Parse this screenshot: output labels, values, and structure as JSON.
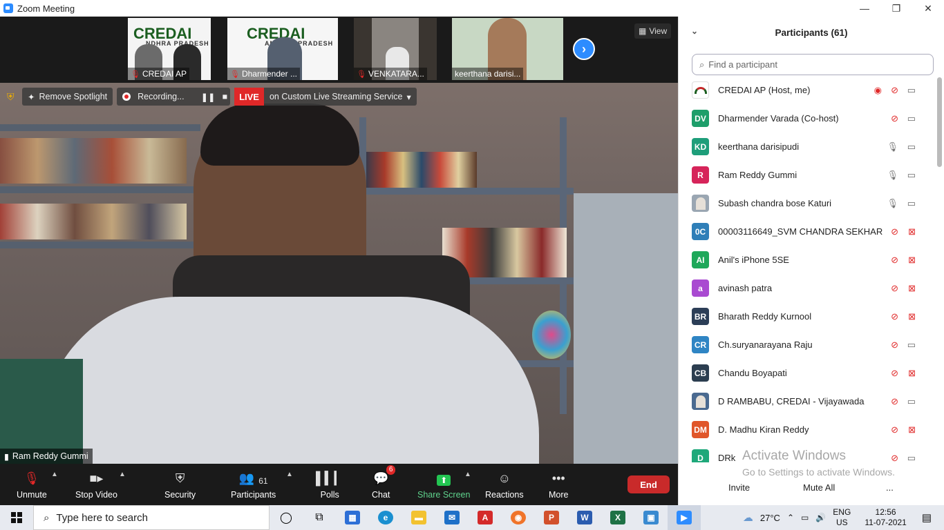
{
  "window": {
    "title": "Zoom Meeting",
    "minimize": "—",
    "maximize": "❐",
    "close": "✕"
  },
  "strip": {
    "thumbnails": [
      {
        "name": "CREDAI AP",
        "logo": "CREDAI",
        "sub": "NDHRA PRADESH"
      },
      {
        "name": "Dharmender ...",
        "logo": "CREDAI",
        "sub": "ANDHRA PRADESH"
      },
      {
        "name": "VENKATARA..."
      },
      {
        "name": "keerthana darisi..."
      }
    ],
    "view_label": "View"
  },
  "stage": {
    "remove_spotlight": "Remove Spotlight",
    "recording": "Recording...",
    "live": "LIVE",
    "stream_service": "on Custom Live Streaming Service",
    "speaker_name": "Ram Reddy Gummi"
  },
  "toolbar": {
    "unmute": "Unmute",
    "stop_video": "Stop Video",
    "security": "Security",
    "participants": "Participants",
    "participants_count": "61",
    "polls": "Polls",
    "chat": "Chat",
    "chat_badge": "6",
    "share_screen": "Share Screen",
    "reactions": "Reactions",
    "more": "More",
    "end": "End"
  },
  "panel": {
    "title": "Participants (61)",
    "search_placeholder": "Find a participant",
    "participants": [
      {
        "initials": "",
        "name": "CREDAI AP (Host, me)",
        "color": "#ffffff",
        "mic": "off",
        "cam": "on",
        "rec": true
      },
      {
        "initials": "DV",
        "name": "Dharmender Varada (Co-host)",
        "color": "#1e9e6a",
        "mic": "off",
        "cam": "on"
      },
      {
        "initials": "KD",
        "name": "keerthana darisipudi",
        "color": "#1e9e7a",
        "mic": "on",
        "cam": "on"
      },
      {
        "initials": "R",
        "name": "Ram Reddy Gummi",
        "color": "#d6245a",
        "mic": "on",
        "cam": "on"
      },
      {
        "initials": "",
        "name": "Subash chandra bose Katuri",
        "color": "#9aa6b2",
        "mic": "on",
        "cam": "on"
      },
      {
        "initials": "0C",
        "name": "00003116649_SVM CHANDRA SEKHAR",
        "color": "#2f7fb8",
        "mic": "off",
        "cam": "off"
      },
      {
        "initials": "AI",
        "name": "Anil's iPhone 5SE",
        "color": "#1ea85a",
        "mic": "off",
        "cam": "off"
      },
      {
        "initials": "a",
        "name": "avinash patra",
        "color": "#a94ad1",
        "mic": "off",
        "cam": "off"
      },
      {
        "initials": "BR",
        "name": "Bharath Reddy Kurnool",
        "color": "#2c3e57",
        "mic": "off",
        "cam": "off"
      },
      {
        "initials": "CR",
        "name": "Ch.suryanarayana Raju",
        "color": "#2f85c4",
        "mic": "off",
        "cam": "on"
      },
      {
        "initials": "CB",
        "name": "Chandu Boyapati",
        "color": "#2c3e50",
        "mic": "off",
        "cam": "off"
      },
      {
        "initials": "",
        "name": "D RAMBABU, CREDAI - Vijayawada",
        "color": "#4a6a90",
        "mic": "off",
        "cam": "on"
      },
      {
        "initials": "DM",
        "name": "D. Madhu Kiran Reddy",
        "color": "#e0562a",
        "mic": "off",
        "cam": "off"
      },
      {
        "initials": "D",
        "name": "DRk",
        "color": "#1ea87a",
        "mic": "off",
        "cam": "on"
      }
    ],
    "invite": "Invite",
    "mute_all": "Mute All",
    "more": "...",
    "activate_title": "Activate Windows",
    "activate_sub": "Go to Settings to activate Windows."
  },
  "taskbar": {
    "search_placeholder": "Type here to search",
    "temperature": "27°C",
    "lang1": "ENG",
    "lang2": "US",
    "time": "12:56",
    "date": "11-07-2021"
  }
}
